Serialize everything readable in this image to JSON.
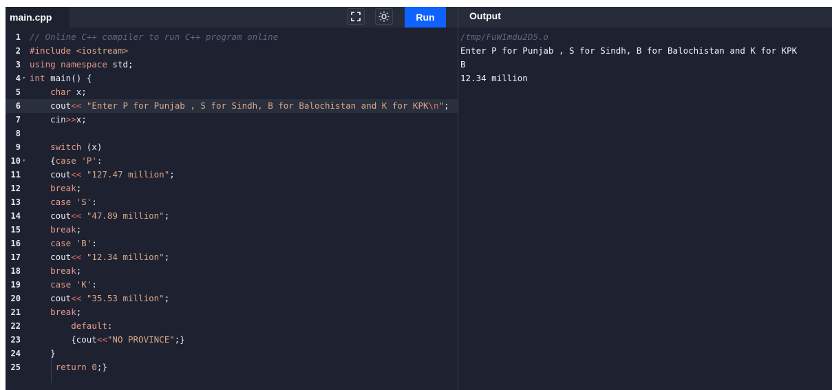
{
  "file_tab": "main.cpp",
  "run_label": "Run",
  "output_title": "Output",
  "icons": {
    "fullscreen": "fullscreen-icon",
    "theme": "sun-icon"
  },
  "editor": {
    "active_line": 6,
    "lines": [
      {
        "n": "1",
        "fold": "",
        "html": "<span class='t-comment'>// Online C++ compiler to run C++ program online</span>"
      },
      {
        "n": "2",
        "fold": "",
        "html": "<span class='t-kw'>#include</span> <span class='t-string'>&lt;iostream&gt;</span>"
      },
      {
        "n": "3",
        "fold": "",
        "html": "<span class='t-kw'>using namespace</span> std;"
      },
      {
        "n": "4",
        "fold": "▾",
        "html": "<span class='t-kw'>int</span> main() {"
      },
      {
        "n": "5",
        "fold": "",
        "html": "    <span class='t-kw'>char</span> x;"
      },
      {
        "n": "6",
        "fold": "",
        "html": "    cout<span class='t-op'>&lt;&lt;</span> <span class='t-string'>\"Enter P for Punjab , S for Sindh, B for Balochistan and K for KPK<span class='t-op'>\\n</span>\"</span>;"
      },
      {
        "n": "7",
        "fold": "",
        "html": "    cin<span class='t-op'>&gt;&gt;</span>x;"
      },
      {
        "n": "8",
        "fold": "",
        "html": ""
      },
      {
        "n": "9",
        "fold": "",
        "html": "    <span class='t-kw'>switch</span> (x)"
      },
      {
        "n": "10",
        "fold": "▾",
        "html": "    {<span class='t-kw'>case</span> <span class='t-string'>'P'</span>:"
      },
      {
        "n": "11",
        "fold": "",
        "html": "    cout<span class='t-op'>&lt;&lt;</span> <span class='t-string'>\"127.47 million\"</span>;"
      },
      {
        "n": "12",
        "fold": "",
        "html": "    <span class='t-kw'>break</span>;"
      },
      {
        "n": "13",
        "fold": "",
        "html": "    <span class='t-kw'>case</span> <span class='t-string'>'S'</span>:"
      },
      {
        "n": "14",
        "fold": "",
        "html": "    cout<span class='t-op'>&lt;&lt;</span> <span class='t-string'>\"47.89 million\"</span>;"
      },
      {
        "n": "15",
        "fold": "",
        "html": "    <span class='t-kw'>break</span>;"
      },
      {
        "n": "16",
        "fold": "",
        "html": "    <span class='t-kw'>case</span> <span class='t-string'>'B'</span>:"
      },
      {
        "n": "17",
        "fold": "",
        "html": "    cout<span class='t-op'>&lt;&lt;</span> <span class='t-string'>\"12.34 million\"</span>;"
      },
      {
        "n": "18",
        "fold": "",
        "html": "    <span class='t-kw'>break</span>;"
      },
      {
        "n": "19",
        "fold": "",
        "html": "    <span class='t-kw'>case</span> <span class='t-string'>'K'</span>:"
      },
      {
        "n": "20",
        "fold": "",
        "html": "    cout<span class='t-op'>&lt;&lt;</span> <span class='t-string'>\"35.53 million\"</span>;"
      },
      {
        "n": "21",
        "fold": "",
        "html": "    <span class='t-kw'>break</span>;"
      },
      {
        "n": "22",
        "fold": "",
        "html": "        <span class='t-kw'>default</span>:"
      },
      {
        "n": "23",
        "fold": "",
        "html": "        {cout<span class='t-op'>&lt;&lt;</span><span class='t-string'>\"NO PROVINCE\"</span>;}"
      },
      {
        "n": "24",
        "fold": "",
        "html": "    }"
      },
      {
        "n": "25",
        "fold": "",
        "html": "     <span class='t-kw'>return</span> <span class='t-string'>0</span>;}"
      }
    ]
  },
  "output": {
    "lines": [
      {
        "text": "/tmp/FuWImdu2D5.o",
        "kind": "path"
      },
      {
        "text": "Enter P for Punjab , S for Sindh, B for Balochistan and K for KPK",
        "kind": "stdout"
      },
      {
        "text": "B",
        "kind": "stdout"
      },
      {
        "text": "12.34 million",
        "kind": "stdout"
      }
    ]
  }
}
